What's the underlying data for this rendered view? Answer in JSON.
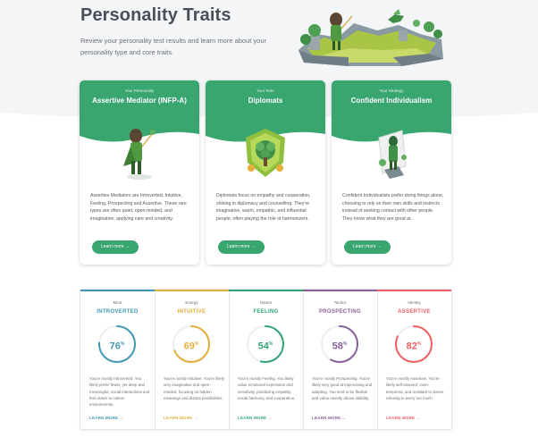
{
  "header": {
    "title": "Personality Traits",
    "subtitle": "Review your personality test results and learn more about your personality type and core traits."
  },
  "colors": {
    "green": "#39a56f",
    "introverted": "#4298b4",
    "intuitive": "#e4ae3a",
    "feeling": "#33a474",
    "prospecting": "#88619a",
    "assertive": "#f25e62"
  },
  "cards": [
    {
      "sup": "Your Personality",
      "name": "Assertive Mediator (INFP-A)",
      "desc": "Assertive Mediators are Introverted, Intuitive, Feeling, Prospecting and Assertive. These rare types are often quiet, open-minded, and imaginative, applying care and creativity.",
      "button": "Learn more →",
      "icon": "mediator-figure"
    },
    {
      "sup": "Your Role",
      "name": "Diplomats",
      "desc": "Diplomats focus on empathy and cooperation, shining in diplomacy and counselling. They're imaginative, warm, empathic, and influential people, often playing the role of harmonizers.",
      "button": "Learn more →",
      "icon": "diplomats-emblem"
    },
    {
      "sup": "Your Strategy",
      "name": "Confident Individualism",
      "desc": "Confident Individualists prefer doing things alone, choosing to rely on their own skills and instincts instead of seeking contact with other people. They know what they are good at.",
      "button": "Learn more →",
      "icon": "individualism-scene"
    }
  ],
  "traits": [
    {
      "category": "Mind",
      "value": "INTROVERTED",
      "percent": 76,
      "percent_label": "76",
      "desc": "You're mostly Introverted. You likely prefer fewer, yet deep and meaningful, social interactions and feel drawn to calmer environments.",
      "link": "LEARN MORE →",
      "color": "#4298b4"
    },
    {
      "category": "Energy",
      "value": "INTUITIVE",
      "percent": 69,
      "percent_label": "69",
      "desc": "You're mostly Intuitive. You're likely very imaginative and open-minded, focusing on hidden meanings and distant possibilities.",
      "link": "LEARN MORE →",
      "color": "#e4ae3a"
    },
    {
      "category": "Nature",
      "value": "FEELING",
      "percent": 54,
      "percent_label": "54",
      "desc": "You're mostly Feeling. You likely value emotional expression and sensitivity, prioritizing empathy, social harmony, and cooperation.",
      "link": "LEARN MORE →",
      "color": "#33a474"
    },
    {
      "category": "Tactics",
      "value": "PROSPECTING",
      "percent": 58,
      "percent_label": "58",
      "desc": "You're mostly Prospecting. You're likely very good at improvising and adapting. You tend to be flexible and value novelty above stability.",
      "link": "LEARN MORE →",
      "color": "#88619a"
    },
    {
      "category": "Identity",
      "value": "ASSERTIVE",
      "percent": 82,
      "percent_label": "82",
      "desc": "You're mostly Assertive. You're likely self-assured, even-tempered, and resistant to stress, refusing to worry too much.",
      "link": "LEARN MORE →",
      "color": "#f25e62"
    }
  ]
}
